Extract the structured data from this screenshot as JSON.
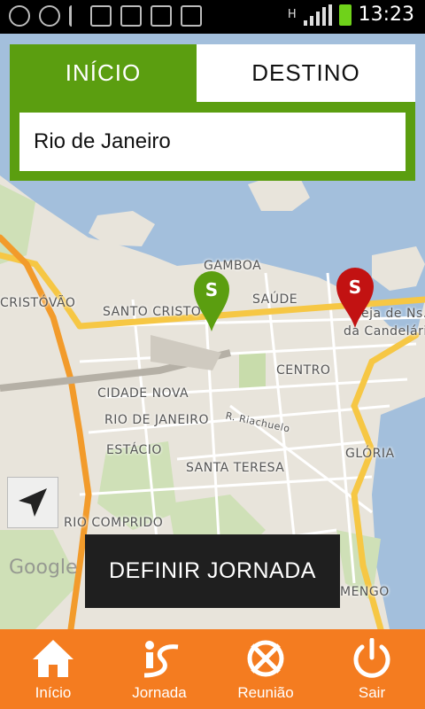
{
  "status_bar": {
    "time": "13:23",
    "network": "H",
    "icons": [
      "add-icon",
      "gps-icon",
      "usb-icon",
      "image-icon",
      "gmail-icon",
      "email-icon",
      "update-icon"
    ]
  },
  "tabs": {
    "start_label": "INÍCIO",
    "destination_label": "DESTINO"
  },
  "search": {
    "value": "Rio de Janeiro"
  },
  "map": {
    "labels": {
      "gamboa": "GAMBOA",
      "saude": "SAÚDE",
      "santo_cristo": "SANTO CRISTO",
      "cristovao": "CRISTÓVÃO",
      "igreja1": "eja de Ns.",
      "igreja2": "da Candelári",
      "centro": "CENTRO",
      "cidade_nova": "CIDADE NOVA",
      "rio_de_janeiro": "RIO DE JANEIRO",
      "riachuelo": "R. Riachuelo",
      "estacio": "ESTÁCIO",
      "santa_teresa": "SANTA TERESA",
      "gloria": "GLÓRIA",
      "rio_comprido": "RIO COMPRIDO",
      "flamengo": "MENGO",
      "google": "Google"
    },
    "start_pin_color": "#5b9e10",
    "destination_pin_color": "#c21212"
  },
  "define_button": {
    "label": "DEFINIR JORNADA"
  },
  "bottom_nav": {
    "color": "#f47c20",
    "items": [
      {
        "label": "Início",
        "icon": "home-icon"
      },
      {
        "label": "Jornada",
        "icon": "journey-icon"
      },
      {
        "label": "Reunião",
        "icon": "meeting-icon"
      },
      {
        "label": "Sair",
        "icon": "power-icon"
      }
    ]
  }
}
